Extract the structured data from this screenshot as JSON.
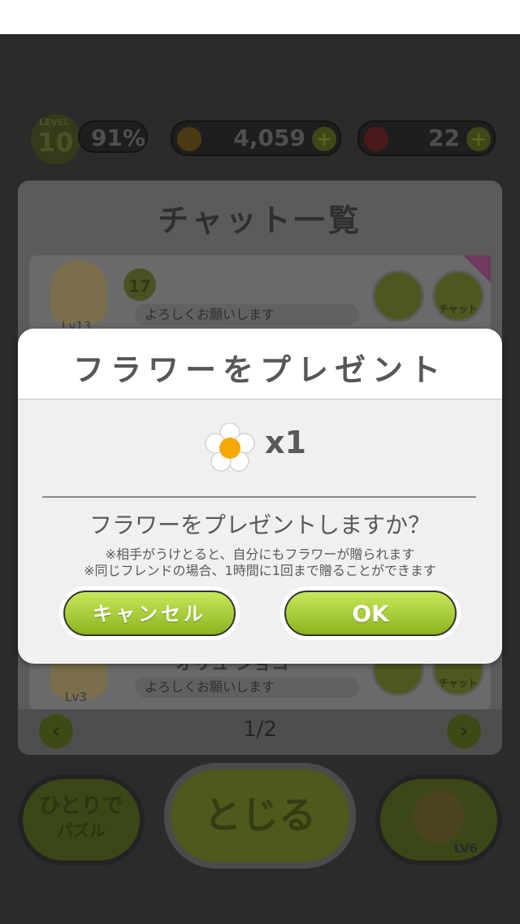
{
  "hud": {
    "level_label": "LEVEL",
    "level_value": "10",
    "level_progress": "91%",
    "coins": "4,059",
    "hearts": "22"
  },
  "chat_panel": {
    "title": "チャット一覧",
    "items": [
      {
        "avatar_level": "Lv13",
        "level": "17",
        "message": "よろしくお願いします",
        "chat_label": "チャット"
      },
      {
        "avatar_level": "Lv3",
        "name_partial": "オリュ ショコ",
        "message": "よろしくお願いします",
        "chat_label": "チャット"
      }
    ],
    "pager": "1/2"
  },
  "bottom_nav": {
    "solo_line1": "ひとりで",
    "solo_line2": "パズル",
    "close": "とじる",
    "friend_level": "LV6"
  },
  "dialog": {
    "title": "フラワーをプレゼント",
    "quantity": "x1",
    "question": "フラワーをプレゼントしますか？",
    "note1": "※相手がうけとると、自分にもフラワーが贈られます",
    "note2": "※同じフレンドの場合、1時間に1回まで贈ることができます",
    "cancel_label": "キャンセル",
    "ok_label": "OK"
  },
  "colors": {
    "button_green": "#b3d93c",
    "dialog_bg": "#f0f0f0",
    "overlay": "#2b2b2b",
    "flower_center": "#f5a800"
  },
  "icons": [
    "flower-icon",
    "coin-icon",
    "heart-icon",
    "plus-icon",
    "chat-bubble-icon",
    "arrow-left-icon",
    "arrow-right-icon"
  ]
}
